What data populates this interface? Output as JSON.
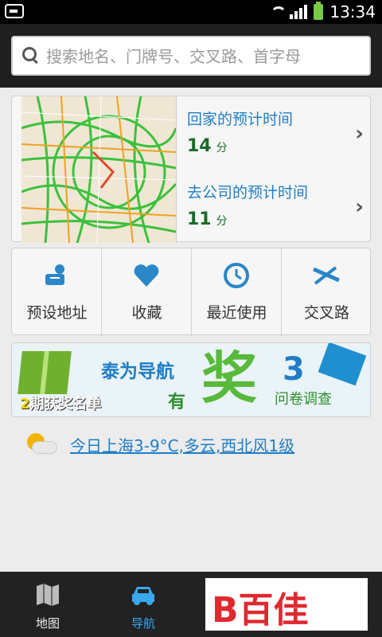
{
  "status_bar": {
    "time": "13:34"
  },
  "search": {
    "placeholder": "搜索地名、门牌号、交叉路、首字母"
  },
  "commute": {
    "home": {
      "label": "回家的预计时间",
      "value": "14",
      "unit": "分"
    },
    "work": {
      "label": "去公司的预计时间",
      "value": "11",
      "unit": "分"
    }
  },
  "quick_actions": [
    {
      "label": "预设地址",
      "icon": "preset-address-icon"
    },
    {
      "label": "收藏",
      "icon": "heart-icon"
    },
    {
      "label": "最近使用",
      "icon": "clock-icon"
    },
    {
      "label": "交叉路",
      "icon": "intersection-icon"
    }
  ],
  "banner": {
    "brand": "泰为导航",
    "you": "有",
    "big": "奖",
    "number": "3",
    "survey": "问卷调查",
    "winners_count": "2",
    "winners_text": "期获奖名单"
  },
  "weather": {
    "text": "今日上海3-9°C,多云,西北风1级",
    "icon": "partly-cloudy-icon"
  },
  "bottom_nav": [
    {
      "label": "地图",
      "icon": "map-icon",
      "active": false
    },
    {
      "label": "导航",
      "icon": "car-icon",
      "active": true
    },
    {
      "label": "",
      "icon": "",
      "active": false
    },
    {
      "label": "",
      "icon": "",
      "active": false
    }
  ],
  "watermark": {
    "text": "百佳",
    "prefix": "B"
  },
  "colors": {
    "accent_blue": "#1f7ec6",
    "green": "#58b93a",
    "header_bg": "#1f1f1f"
  }
}
